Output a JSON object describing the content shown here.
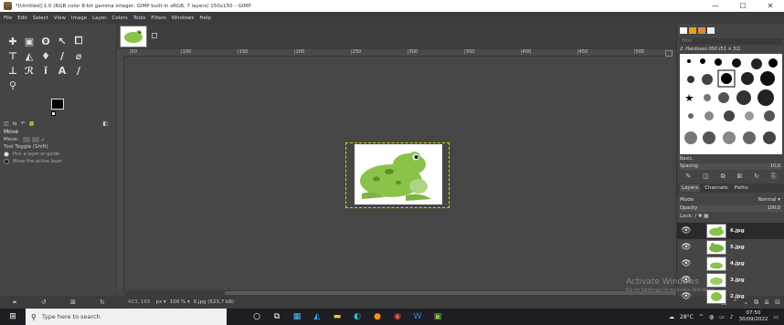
{
  "window": {
    "title": "*[Untitled]-1.0 (RGB color 8-bit gamma integer, GIMP built-in sRGB, 7 layers) 150x150 – GIMP",
    "minimize": "—",
    "maximize": "☐",
    "close": "✕"
  },
  "menu": [
    "File",
    "Edit",
    "Select",
    "View",
    "Image",
    "Layer",
    "Colors",
    "Tools",
    "Filters",
    "Windows",
    "Help"
  ],
  "tool_options": {
    "title": "Move",
    "move_label": "Move:",
    "toggle_label": "Tool Toggle  (Shift)",
    "option1": "Pick a layer or guide",
    "option2": "Move the active layer"
  },
  "ruler": [
    "|50",
    "|100",
    "|150",
    "|200",
    "|250",
    "|300",
    "|350",
    "|400",
    "|450",
    "|500"
  ],
  "status": {
    "coords": "423, 165",
    "unit": "px ▾",
    "zoom": "100 % ▾",
    "file": "6.jpg (523,7 kB)"
  },
  "dock": {
    "filter_placeholder": "filter",
    "brush_name": "2. Hardness 050 (51 × 51)",
    "brush_category": "Basic,",
    "spacing_label": "Spacing",
    "spacing_value": "10,0",
    "tab_layers": "Layers",
    "tab_channels": "Channels",
    "tab_paths": "Paths",
    "mode_label": "Mode",
    "mode_value": "Normal ▾",
    "opacity_label": "Opacity",
    "opacity_value": "100,0",
    "lock_label": "Lock:",
    "layers": [
      {
        "name": "6.jpg"
      },
      {
        "name": "5.jpg"
      },
      {
        "name": "4.jpg"
      },
      {
        "name": "3.jpg"
      },
      {
        "name": "2.jpg"
      }
    ],
    "activate_title": "Activate Windows",
    "activate_sub": "Go to Settings to activate Windows."
  },
  "taskbar": {
    "search_placeholder": "Type here to search",
    "temperature": "28°C",
    "time": "07:50",
    "date": "30/09/2022"
  },
  "colors": {
    "frog_green": "#8bc34a",
    "frog_dark": "#5a8f2a",
    "selection_yellow": "#d6d600"
  }
}
